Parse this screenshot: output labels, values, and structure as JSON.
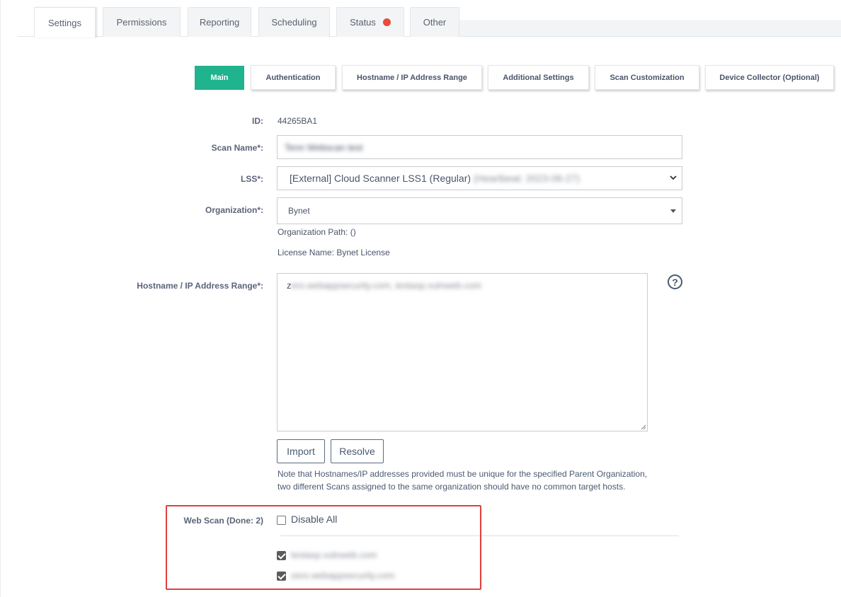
{
  "top_tabs": [
    {
      "label": "Settings"
    },
    {
      "label": "Permissions"
    },
    {
      "label": "Reporting"
    },
    {
      "label": "Scheduling"
    },
    {
      "label": "Status",
      "indicator_color": "#e74c3c"
    },
    {
      "label": "Other"
    }
  ],
  "sub_tabs": [
    {
      "label": "Main"
    },
    {
      "label": "Authentication"
    },
    {
      "label": "Hostname / IP Address Range"
    },
    {
      "label": "Additional Settings"
    },
    {
      "label": "Scan Customization"
    },
    {
      "label": "Device Collector (Optional)"
    }
  ],
  "form": {
    "id_label": "ID:",
    "id_value": "44265BA1",
    "scan_name_label": "Scan Name*:",
    "scan_name_value": "Tenn Webscan test",
    "lss_label": "LSS*:",
    "lss_value": "[External] Cloud Scanner LSS1 (Regular)",
    "lss_value_blurred": "(Heartbeat: 2023-06-27)",
    "org_label": "Organization*:",
    "org_value": "Bynet",
    "org_path": "Organization Path: ()",
    "license_name": "License Name: Bynet License",
    "range_label": "Hostname / IP Address Range*:",
    "range_value_prefix": "z",
    "range_value_blurred": "ero.webappsecurity.com, testasp.vulnweb.com",
    "help_icon_text": "?",
    "import_label": "Import",
    "resolve_label": "Resolve",
    "note_line1": "Note that Hostnames/IP addresses provided must be unique for the specified Parent Organization,",
    "note_line2": "two different Scans assigned to the same organization should have no common target hosts.",
    "web_scan_label": "Web Scan (Done: 2)",
    "disable_all_label": "Disable All",
    "hosts": [
      {
        "name": "testasp.vulnweb.com",
        "checked": true
      },
      {
        "name": "zero.webappsecurity.com",
        "checked": true
      }
    ]
  },
  "colors": {
    "accent": "#1fb38e",
    "highlight_border": "#e0403c",
    "status_dot": "#e74c3c"
  }
}
